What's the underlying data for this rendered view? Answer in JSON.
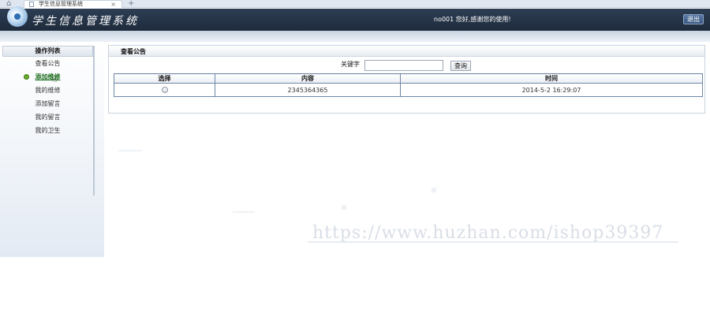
{
  "browser": {
    "tab_title": "学生信息管理系统",
    "tab_close": "×",
    "new_tab": "+"
  },
  "header": {
    "app_title": "学生信息管理系统",
    "welcome_text": "no001 您好,感谢您的使用!",
    "logout_label": "退出"
  },
  "sidebar": {
    "title": "操作列表",
    "items": [
      {
        "label": "查看公告",
        "active": false
      },
      {
        "label": "添加维修",
        "active": true
      },
      {
        "label": "我的维修",
        "active": false
      },
      {
        "label": "添加留言",
        "active": false
      },
      {
        "label": "我的留言",
        "active": false
      },
      {
        "label": "我的卫生",
        "active": false
      }
    ]
  },
  "main": {
    "panel_title": "查看公告",
    "search": {
      "label": "关键字",
      "value": "",
      "button_label": "查询"
    },
    "table": {
      "columns": [
        "选择",
        "内容",
        "时间"
      ],
      "rows": [
        {
          "content": "2345364365",
          "time": "2014-5-2 16:29:07"
        }
      ]
    }
  },
  "watermark": "https://www.huzhan.com/ishop39397",
  "colors": {
    "header_bg": "#1e2b3c",
    "table_border": "#6d87a6",
    "active_item": "#1f6e1f"
  },
  "icons": [
    "home-icon",
    "page-icon",
    "logo-icon",
    "bullet-icon",
    "cursor-icon",
    "radio-icon"
  ]
}
